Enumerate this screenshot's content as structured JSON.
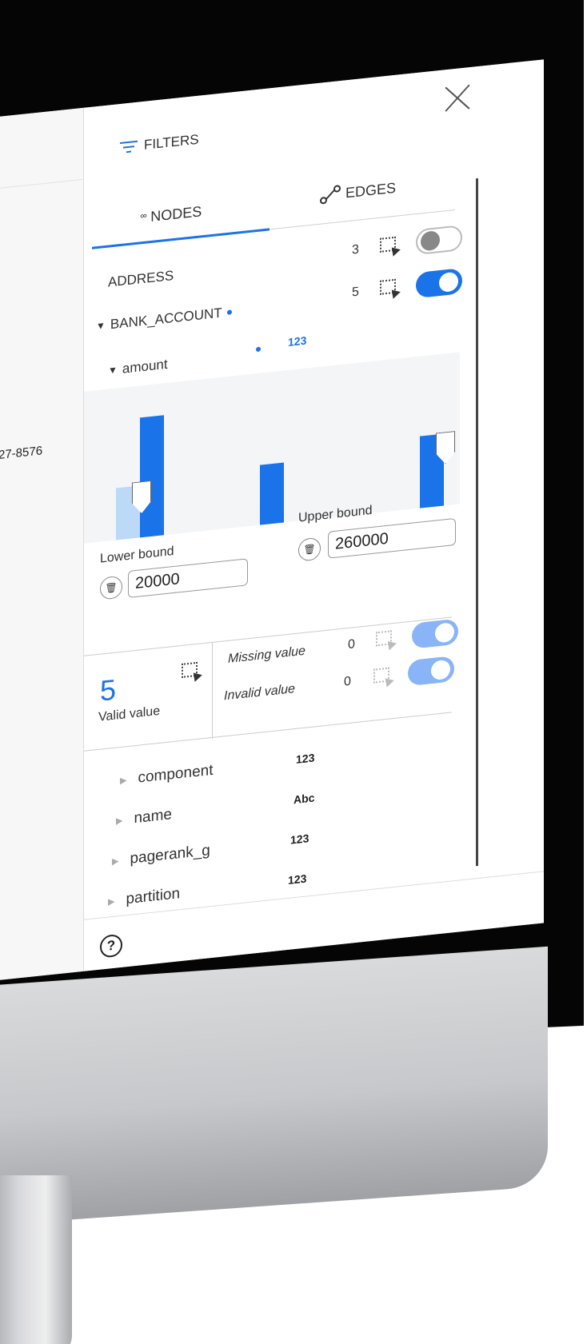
{
  "colors": {
    "accent": "#1a73e8",
    "accent_light": "#8ab4f8"
  },
  "graph": {
    "partial_label": "27-8576"
  },
  "panel": {
    "title": "FILTERS",
    "close_icon": "close-icon",
    "tabs": [
      {
        "label": "NODES",
        "icon": "nodes-icon",
        "active": true
      },
      {
        "label": "EDGES",
        "icon": "edges-icon",
        "active": false
      }
    ],
    "node_types": [
      {
        "label": "ADDRESS",
        "count": "3",
        "enabled": false
      },
      {
        "label": "BANK_ACCOUNT",
        "count": "5",
        "enabled": true
      }
    ],
    "property": {
      "label": "amount",
      "type_badge": "123"
    },
    "histogram": {
      "bins": [
        {
          "value": 5,
          "selected": false
        },
        {
          "value": 10,
          "selected": true
        },
        {
          "value": 5,
          "selected": true
        },
        {
          "value": 6,
          "selected": true
        }
      ]
    },
    "lower_bound": {
      "label": "Lower bound",
      "value": "20000"
    },
    "upper_bound": {
      "label": "Upper bound",
      "value": "260000"
    },
    "stats": {
      "valid_count": "5",
      "valid_label": "Valid value",
      "missing_label": "Missing value",
      "missing_count": "0",
      "invalid_label": "Invalid value",
      "invalid_count": "0"
    },
    "attributes": [
      {
        "label": "component",
        "type": "123"
      },
      {
        "label": "name",
        "type": "Abc"
      },
      {
        "label": "pagerank_g",
        "type": "123"
      },
      {
        "label": "partition",
        "type": "123"
      }
    ],
    "help_icon": "help-icon"
  }
}
